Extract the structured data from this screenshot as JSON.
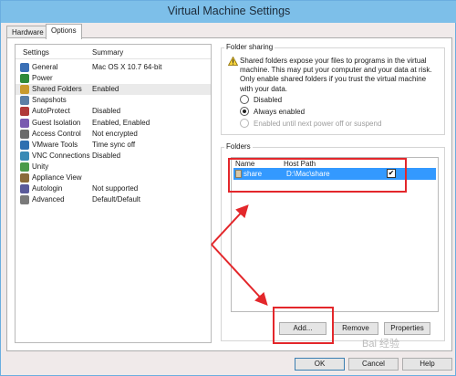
{
  "window": {
    "title": "Virtual Machine Settings"
  },
  "tabs": [
    {
      "label": "Hardware"
    },
    {
      "label": "Options"
    }
  ],
  "settings": {
    "col_settings": "Settings",
    "col_summary": "Summary",
    "items": [
      {
        "name": "General",
        "summary": "Mac OS X 10.7 64-bit",
        "icon": "general-icon"
      },
      {
        "name": "Power",
        "summary": "",
        "icon": "power-icon"
      },
      {
        "name": "Shared Folders",
        "summary": "Enabled",
        "icon": "shared-folders-icon"
      },
      {
        "name": "Snapshots",
        "summary": "",
        "icon": "snapshots-icon"
      },
      {
        "name": "AutoProtect",
        "summary": "Disabled",
        "icon": "autoprotect-icon"
      },
      {
        "name": "Guest Isolation",
        "summary": "Enabled, Enabled",
        "icon": "guest-isolation-icon"
      },
      {
        "name": "Access Control",
        "summary": "Not encrypted",
        "icon": "access-control-icon"
      },
      {
        "name": "VMware Tools",
        "summary": "Time sync off",
        "icon": "vmware-tools-icon"
      },
      {
        "name": "VNC Connections",
        "summary": "Disabled",
        "icon": "vnc-icon"
      },
      {
        "name": "Unity",
        "summary": "",
        "icon": "unity-icon"
      },
      {
        "name": "Appliance View",
        "summary": "",
        "icon": "appliance-view-icon"
      },
      {
        "name": "Autologin",
        "summary": "Not supported",
        "icon": "autologin-icon"
      },
      {
        "name": "Advanced",
        "summary": "Default/Default",
        "icon": "advanced-icon"
      }
    ]
  },
  "folder_sharing": {
    "title": "Folder sharing",
    "warning": "Shared folders expose your files to programs in the virtual machine. This may put your computer and your data at risk. Only enable shared folders if you trust the virtual machine with your data.",
    "options": [
      {
        "label": "Disabled",
        "checked": false,
        "enabled": true
      },
      {
        "label": "Always enabled",
        "checked": true,
        "enabled": true
      },
      {
        "label": "Enabled until next power off or suspend",
        "checked": false,
        "enabled": false
      }
    ]
  },
  "folders": {
    "title": "Folders",
    "col_name": "Name",
    "col_host_path": "Host Path",
    "rows": [
      {
        "name": "share",
        "host_path": "D:\\Mac\\share",
        "enabled_mark": "✔"
      }
    ],
    "add_label": "Add...",
    "remove_label": "Remove",
    "properties_label": "Properties"
  },
  "footer": {
    "ok_label": "OK",
    "cancel_label": "Cancel",
    "help_label": "Help"
  },
  "watermark": "Bai 经验",
  "colors": {
    "titlebar": "#7dbfe9",
    "selection": "#3399ff",
    "annotation": "#e3272b"
  }
}
